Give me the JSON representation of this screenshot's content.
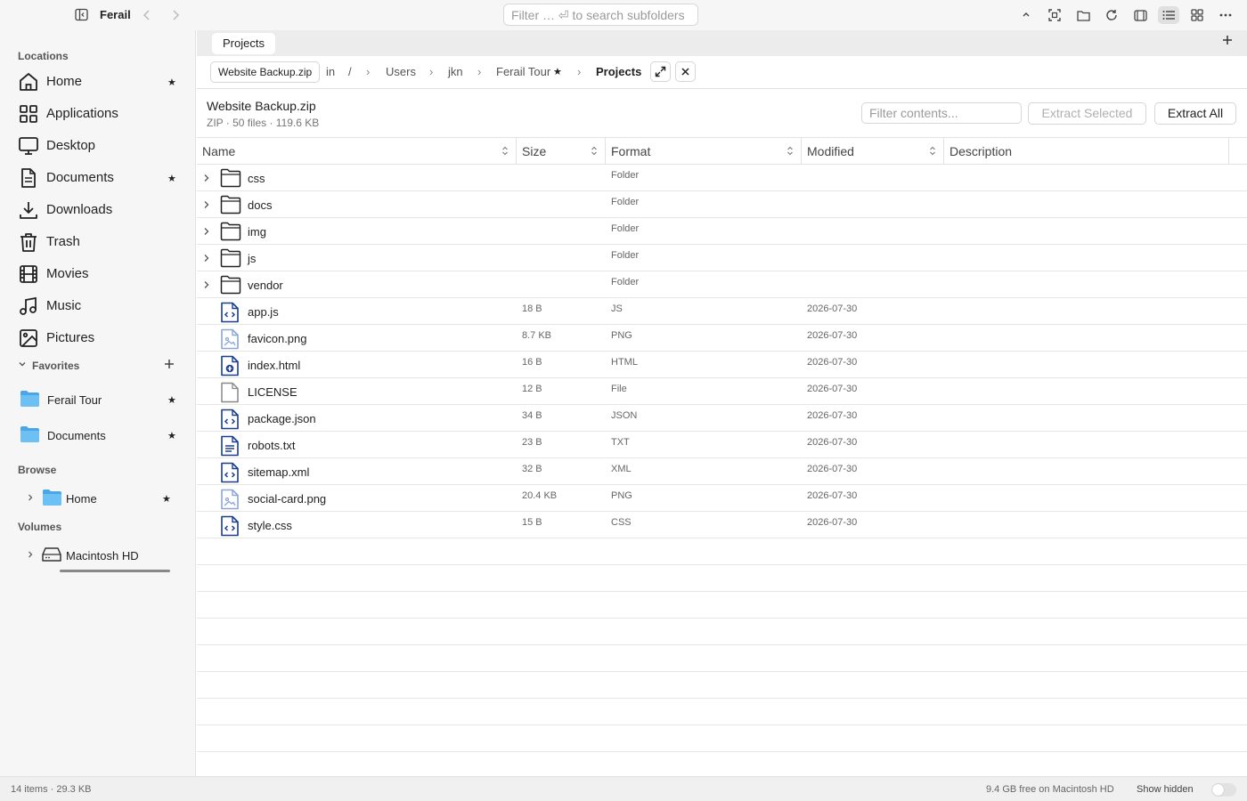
{
  "app": {
    "title": "Ferail"
  },
  "search": {
    "placeholder": "Filter … ⏎ to search subfolders"
  },
  "sidebar": {
    "locations_title": "Locations",
    "locations": [
      {
        "label": "Home",
        "icon": "home-icon",
        "starred": true
      },
      {
        "label": "Applications",
        "icon": "applications-icon",
        "starred": false
      },
      {
        "label": "Desktop",
        "icon": "desktop-icon",
        "starred": false
      },
      {
        "label": "Documents",
        "icon": "document-icon",
        "starred": true
      },
      {
        "label": "Downloads",
        "icon": "download-icon",
        "starred": false
      },
      {
        "label": "Trash",
        "icon": "trash-icon",
        "starred": false
      },
      {
        "label": "Movies",
        "icon": "film-icon",
        "starred": false
      },
      {
        "label": "Music",
        "icon": "music-icon",
        "starred": false
      },
      {
        "label": "Pictures",
        "icon": "pictures-icon",
        "starred": false
      }
    ],
    "favorites_title": "Favorites",
    "favorites": [
      {
        "label": "Ferail Tour",
        "starred": true
      },
      {
        "label": "Documents",
        "starred": true
      }
    ],
    "browse_title": "Browse",
    "browse": [
      {
        "label": "Home",
        "starred": true
      }
    ],
    "volumes_title": "Volumes",
    "volumes": [
      {
        "label": "Macintosh HD"
      }
    ]
  },
  "tabs": [
    {
      "label": "Projects"
    }
  ],
  "path": {
    "archive": "Website Backup.zip",
    "in_label": "in",
    "root": "/",
    "segments": [
      "Users",
      "jkn",
      "Ferail Tour",
      "Projects"
    ]
  },
  "archive": {
    "name": "Website Backup.zip",
    "meta": "ZIP · 50 files · 119.6 KB",
    "filter_placeholder": "Filter contents...",
    "extract_selected": "Extract Selected",
    "extract_all": "Extract All"
  },
  "table": {
    "columns": [
      "Name",
      "Size",
      "Format",
      "Modified",
      "Description"
    ],
    "rows": [
      {
        "name": "css",
        "size": "",
        "format": "Folder",
        "modified": "",
        "type": "folder"
      },
      {
        "name": "docs",
        "size": "",
        "format": "Folder",
        "modified": "",
        "type": "folder"
      },
      {
        "name": "img",
        "size": "",
        "format": "Folder",
        "modified": "",
        "type": "folder"
      },
      {
        "name": "js",
        "size": "",
        "format": "Folder",
        "modified": "",
        "type": "folder"
      },
      {
        "name": "vendor",
        "size": "",
        "format": "Folder",
        "modified": "",
        "type": "folder"
      },
      {
        "name": "app.js",
        "size": "18 B",
        "format": "JS",
        "modified": "2026-07-30",
        "type": "code"
      },
      {
        "name": "favicon.png",
        "size": "8.7 KB",
        "format": "PNG",
        "modified": "2026-07-30",
        "type": "image"
      },
      {
        "name": "index.html",
        "size": "16 B",
        "format": "HTML",
        "modified": "2026-07-30",
        "type": "html"
      },
      {
        "name": "LICENSE",
        "size": "12 B",
        "format": "File",
        "modified": "2026-07-30",
        "type": "plain"
      },
      {
        "name": "package.json",
        "size": "34 B",
        "format": "JSON",
        "modified": "2026-07-30",
        "type": "code"
      },
      {
        "name": "robots.txt",
        "size": "23 B",
        "format": "TXT",
        "modified": "2026-07-30",
        "type": "text"
      },
      {
        "name": "sitemap.xml",
        "size": "32 B",
        "format": "XML",
        "modified": "2026-07-30",
        "type": "code"
      },
      {
        "name": "social-card.png",
        "size": "20.4 KB",
        "format": "PNG",
        "modified": "2026-07-30",
        "type": "image"
      },
      {
        "name": "style.css",
        "size": "15 B",
        "format": "CSS",
        "modified": "2026-07-30",
        "type": "code"
      }
    ]
  },
  "status": {
    "items": "14 items · 29.3 KB",
    "free": "9.4 GB free on Macintosh HD",
    "show_hidden": "Show hidden"
  },
  "colors": {
    "accent": "#1a3e8c",
    "folder_blue": "#5ab4ec"
  }
}
